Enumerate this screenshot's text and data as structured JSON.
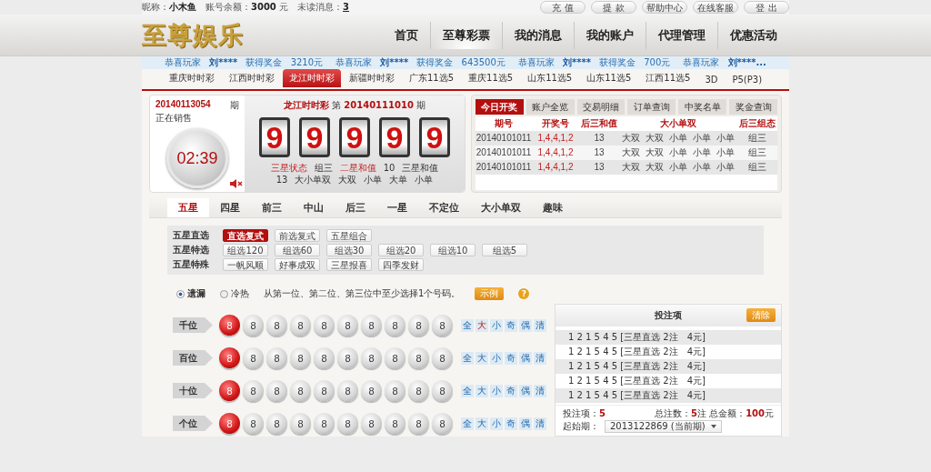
{
  "user_bar": {
    "nickname_label": "昵称：",
    "nickname": "小木鱼",
    "balance_label": "账号余额：",
    "balance": "3000",
    "balance_unit": "元",
    "unread_label": "未读消息：",
    "unread": "3"
  },
  "top_buttons": [
    "充 值",
    "提 款",
    "帮助中心",
    "在线客服",
    "登 出"
  ],
  "logo": "至尊娱乐",
  "nav": [
    {
      "label": "首页",
      "selected": false
    },
    {
      "label": "至尊彩票",
      "selected": true
    },
    {
      "label": "我的消息",
      "selected": false
    },
    {
      "label": "我的账户",
      "selected": false
    },
    {
      "label": "代理管理",
      "selected": false
    },
    {
      "label": "优惠活动",
      "selected": false
    }
  ],
  "winners": [
    {
      "prefix": "恭喜玩家",
      "name": "刘****",
      "action": "获得奖金",
      "amount": "3210元"
    },
    {
      "prefix": "恭喜玩家",
      "name": "刘****",
      "action": "获得奖金",
      "amount": "643500元"
    },
    {
      "prefix": "恭喜玩家",
      "name": "刘****",
      "action": "获得奖金",
      "amount": "700元"
    },
    {
      "prefix": "恭喜玩家",
      "name": "刘****..."
    }
  ],
  "lottery_tabs": [
    {
      "label": "重庆时时彩",
      "selected": false
    },
    {
      "label": "江西时时彩",
      "selected": false
    },
    {
      "label": "龙江时时彩",
      "selected": true
    },
    {
      "label": "新疆时时彩",
      "selected": false
    },
    {
      "label": "广东11选5",
      "selected": false
    },
    {
      "label": "重庆11选5",
      "selected": false
    },
    {
      "label": "山东11选5",
      "selected": false
    },
    {
      "label": "山东11选5",
      "selected": false
    },
    {
      "label": "江西11选5",
      "selected": false
    },
    {
      "label": "3D",
      "selected": false
    },
    {
      "label": "P5(P3)",
      "selected": false
    }
  ],
  "draw": {
    "current_issue": "20140113054",
    "issue_suffix": "期",
    "status": "正在销售",
    "countdown": "02:39",
    "muted": true,
    "game": "龙江时时彩",
    "prev_prefix": "第",
    "prev_issue": "20140111010",
    "prev_suffix": "期",
    "digits": [
      "9",
      "9",
      "9",
      "9",
      "9"
    ],
    "stats_lines": [
      [
        {
          "text": "三星状态",
          "highlight": true
        },
        {
          "text": "组三",
          "highlight": false
        },
        {
          "text": "二星和值",
          "highlight": true
        },
        {
          "text": "10",
          "highlight": false
        },
        {
          "text": "三星和值",
          "highlight": false
        }
      ],
      [
        {
          "text": "13",
          "highlight": false
        },
        {
          "text": "大小单双",
          "highlight": false
        },
        {
          "text": "大双",
          "highlight": false
        },
        {
          "text": "小单",
          "highlight": false
        },
        {
          "text": "大单",
          "highlight": false
        },
        {
          "text": "小单",
          "highlight": false
        }
      ]
    ]
  },
  "results": {
    "tabs": [
      {
        "label": "今日开奖",
        "selected": true
      },
      {
        "label": "账户全览",
        "selected": false
      },
      {
        "label": "交易明细",
        "selected": false
      },
      {
        "label": "订单查询",
        "selected": false
      },
      {
        "label": "中奖名单",
        "selected": false
      },
      {
        "label": "奖金查询",
        "selected": false
      }
    ],
    "columns": [
      "期号",
      "开奖号",
      "后三和值",
      "大小单双",
      "后三组态"
    ],
    "rows": [
      {
        "issue": "20140101011",
        "numbers": "1,4,4,1,2",
        "sum": "13",
        "sizes": [
          "大双",
          "大双",
          "小单",
          "小单",
          "小单"
        ],
        "pattern": "组三"
      },
      {
        "issue": "20140101011",
        "numbers": "1,4,4,1,2",
        "sum": "13",
        "sizes": [
          "大双",
          "大双",
          "小单",
          "小单",
          "小单"
        ],
        "pattern": "组三"
      },
      {
        "issue": "20140101011",
        "numbers": "1,4,4,1,2",
        "sum": "13",
        "sizes": [
          "大双",
          "大双",
          "小单",
          "小单",
          "小单"
        ],
        "pattern": "组三"
      }
    ]
  },
  "play_tabs": [
    {
      "label": "五星",
      "selected": true
    },
    {
      "label": "四星",
      "selected": false
    },
    {
      "label": "前三",
      "selected": false
    },
    {
      "label": "中山",
      "selected": false
    },
    {
      "label": "后三",
      "selected": false
    },
    {
      "label": "一星",
      "selected": false
    },
    {
      "label": "不定位",
      "selected": false
    },
    {
      "label": "大小单双",
      "selected": false
    },
    {
      "label": "趣味",
      "selected": false
    }
  ],
  "play_groups": [
    {
      "label": "五星直选",
      "options": [
        {
          "label": "直选复式",
          "selected": true
        },
        {
          "label": "前选复式",
          "selected": false
        },
        {
          "label": "五星组合",
          "selected": false
        }
      ]
    },
    {
      "label": "五星特选",
      "options": [
        {
          "label": "组选120",
          "selected": false
        },
        {
          "label": "组选60",
          "selected": false
        },
        {
          "label": "组选30",
          "selected": false
        },
        {
          "label": "组选20",
          "selected": false
        },
        {
          "label": "组选10",
          "selected": false
        },
        {
          "label": "组选5",
          "selected": false
        }
      ]
    },
    {
      "label": "五星特殊",
      "options": [
        {
          "label": "一帆风顺",
          "selected": false
        },
        {
          "label": "好事成双",
          "selected": false
        },
        {
          "label": "三星报喜",
          "selected": false
        },
        {
          "label": "四季发财",
          "selected": false
        }
      ]
    }
  ],
  "display_modes": [
    {
      "label": "遗漏",
      "selected": true
    },
    {
      "label": "冷热",
      "selected": false
    }
  ],
  "hint": "从第一位、第二位、第三位中至少选择1个号码。",
  "example_button": "示例",
  "help_mark": "?",
  "positions": [
    {
      "label": "千位",
      "balls": [
        {
          "number": "8",
          "selected": true
        },
        {
          "number": "8",
          "selected": false
        },
        {
          "number": "8",
          "selected": false
        },
        {
          "number": "8",
          "selected": false
        },
        {
          "number": "8",
          "selected": false
        },
        {
          "number": "8",
          "selected": false
        },
        {
          "number": "8",
          "selected": false
        },
        {
          "number": "8",
          "selected": false
        },
        {
          "number": "8",
          "selected": false
        },
        {
          "number": "8",
          "selected": false
        }
      ],
      "quick": [
        {
          "label": "全",
          "selected": false
        },
        {
          "label": "大",
          "selected": true
        },
        {
          "label": "小",
          "selected": false
        },
        {
          "label": "奇",
          "selected": false
        },
        {
          "label": "偶",
          "selected": false
        },
        {
          "label": "清",
          "selected": false
        }
      ]
    },
    {
      "label": "百位",
      "balls": [
        {
          "number": "8",
          "selected": true
        },
        {
          "number": "8",
          "selected": false
        },
        {
          "number": "8",
          "selected": false
        },
        {
          "number": "8",
          "selected": false
        },
        {
          "number": "8",
          "selected": false
        },
        {
          "number": "8",
          "selected": false
        },
        {
          "number": "8",
          "selected": false
        },
        {
          "number": "8",
          "selected": false
        },
        {
          "number": "8",
          "selected": false
        },
        {
          "number": "8",
          "selected": false
        }
      ],
      "quick": [
        {
          "label": "全",
          "selected": false
        },
        {
          "label": "大",
          "selected": false
        },
        {
          "label": "小",
          "selected": false
        },
        {
          "label": "奇",
          "selected": false
        },
        {
          "label": "偶",
          "selected": false
        },
        {
          "label": "清",
          "selected": false
        }
      ]
    },
    {
      "label": "十位",
      "balls": [
        {
          "number": "8",
          "selected": true
        },
        {
          "number": "8",
          "selected": false
        },
        {
          "number": "8",
          "selected": false
        },
        {
          "number": "8",
          "selected": false
        },
        {
          "number": "8",
          "selected": false
        },
        {
          "number": "8",
          "selected": false
        },
        {
          "number": "8",
          "selected": false
        },
        {
          "number": "8",
          "selected": false
        },
        {
          "number": "8",
          "selected": false
        },
        {
          "number": "8",
          "selected": false
        }
      ],
      "quick": [
        {
          "label": "全",
          "selected": false
        },
        {
          "label": "大",
          "selected": false
        },
        {
          "label": "小",
          "selected": false
        },
        {
          "label": "奇",
          "selected": false
        },
        {
          "label": "偶",
          "selected": false
        },
        {
          "label": "清",
          "selected": false
        }
      ]
    },
    {
      "label": "个位",
      "balls": [
        {
          "number": "8",
          "selected": true
        },
        {
          "number": "8",
          "selected": false
        },
        {
          "number": "8",
          "selected": false
        },
        {
          "number": "8",
          "selected": false
        },
        {
          "number": "8",
          "selected": false
        },
        {
          "number": "8",
          "selected": false
        },
        {
          "number": "8",
          "selected": false
        },
        {
          "number": "8",
          "selected": false
        },
        {
          "number": "8",
          "selected": false
        },
        {
          "number": "8",
          "selected": false
        }
      ],
      "quick": [
        {
          "label": "全",
          "selected": false
        },
        {
          "label": "大",
          "selected": false
        },
        {
          "label": "小",
          "selected": false
        },
        {
          "label": "奇",
          "selected": false
        },
        {
          "label": "偶",
          "selected": false
        },
        {
          "label": "清",
          "selected": false
        }
      ]
    }
  ],
  "bet_panel": {
    "title": "投注项",
    "clear_button": "清除",
    "items": [
      {
        "numbers": "1 2 1 5 4 5",
        "detail": "[三星直选 2注　4元]"
      },
      {
        "numbers": "1 2 1 5 4 5",
        "detail": "[三星直选 2注　4元]"
      },
      {
        "numbers": "1 2 1 5 4 5",
        "detail": "[三星直选 2注　4元]"
      },
      {
        "numbers": "1 2 1 5 4 5",
        "detail": "[三星直选 2注　4元]"
      },
      {
        "numbers": "1 2 1 5 4 5",
        "detail": "[三星直选 2注　4元]"
      }
    ],
    "count_label": "投注项：",
    "count": "5",
    "total_bets_label": "总注数：",
    "total_bets": "5",
    "total_bets_unit": "注",
    "total_amount_label": "总金额：",
    "total_amount": "100",
    "total_amount_unit": "元",
    "start_label": "起始期：",
    "start_value": "2013122869 (当前期)"
  }
}
